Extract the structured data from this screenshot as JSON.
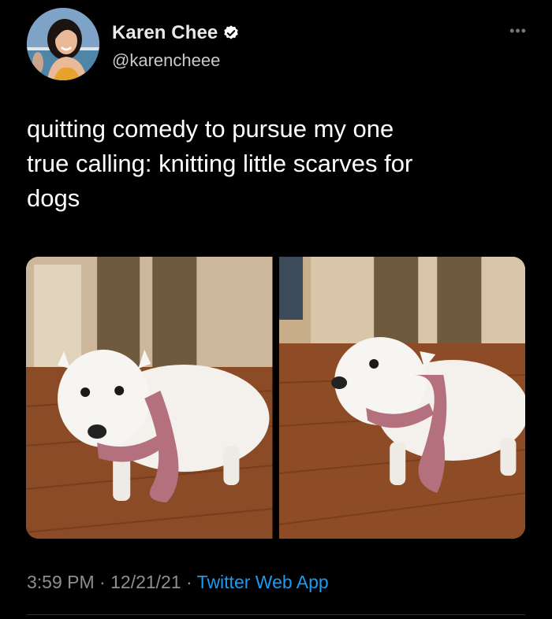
{
  "author": {
    "display_name": "Karen Chee",
    "handle": "@karencheee",
    "verified": true
  },
  "tweet": {
    "text": "quitting comedy to pursue my one\ntrue calling: knitting little scarves for\ndogs",
    "media": [
      {
        "label": "white-dog-in-pink-scarf-photo-1"
      },
      {
        "label": "white-dog-in-pink-scarf-photo-2"
      }
    ]
  },
  "meta": {
    "time": "3:59 PM",
    "separator1": " · ",
    "date": "12/21/21",
    "separator2": " · ",
    "source": "Twitter Web App"
  },
  "icons": {
    "verified": "verified-badge-icon",
    "more": "more-options-icon"
  },
  "colors": {
    "background": "#000000",
    "text": "#e7e9ea",
    "secondary": "#8b8f94",
    "link": "#1d9bf0",
    "scarf": "#b5707e"
  }
}
